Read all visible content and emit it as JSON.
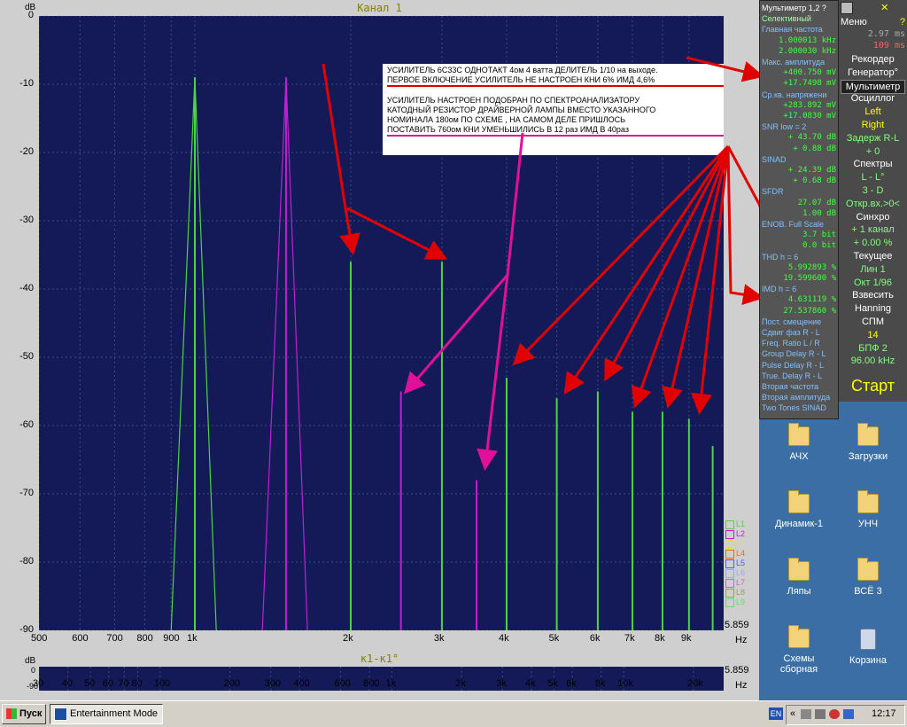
{
  "window": {
    "channel_title": "Канал 1",
    "sub_title": "к1-к1°",
    "db_unit": "dB",
    "hz_unit": "Hz",
    "corner_value": "5.859",
    "sub_corner_value": "5.859",
    "sub_y0": "0",
    "sub_y1": "-90"
  },
  "chart_data": {
    "type": "bar",
    "title": "Канал 1",
    "ylabel": "dB",
    "xlabel": "Hz",
    "xscale": "log",
    "xlim": [
      500,
      10500
    ],
    "ylim": [
      -90,
      0
    ],
    "yticks": [
      "0",
      "-10",
      "-20",
      "-30",
      "-40",
      "-50",
      "-60",
      "-70",
      "-80",
      "-90"
    ],
    "xticks": [
      "500",
      "600",
      "700",
      "800",
      "900",
      "1k",
      "2k",
      "3k",
      "4k",
      "5k",
      "6k",
      "7k",
      "8k",
      "9k"
    ],
    "grid": true,
    "series": [
      {
        "name": "L1",
        "color": "#4ad640",
        "x": [
          1000,
          2000,
          3000,
          4000,
          5000,
          6000,
          7000,
          8000,
          9000,
          10000
        ],
        "values": [
          -9,
          -36,
          -36,
          -53,
          -56,
          -55,
          -58,
          -58,
          -59,
          -63
        ]
      },
      {
        "name": "L2",
        "color": "#c020d0",
        "x": [
          1500,
          2500,
          3500
        ],
        "values": [
          -9,
          -55,
          -68
        ]
      }
    ],
    "legend": [
      "L1",
      "L2",
      "L3",
      "L4",
      "L5",
      "L6",
      "L7",
      "L8",
      "L9"
    ],
    "legend_colors": [
      "#4ad640",
      "#c020d0",
      "#e0e040",
      "#e07020",
      "#4060ff",
      "#a0a0ff",
      "#d060d0",
      "#a0a050",
      "#60e060"
    ],
    "legend_placement": "bottom-right"
  },
  "sub_chart": {
    "xticks": [
      "30",
      "40",
      "50",
      "60",
      "70",
      "80",
      "100",
      "200",
      "300",
      "400",
      "600",
      "800",
      "1k",
      "2k",
      "3k",
      "4k",
      "5k",
      "6k",
      "8k",
      "10k",
      "20k"
    ],
    "xlim": [
      30,
      27000
    ]
  },
  "annotation": {
    "lines1": [
      "УСИЛИТЕЛЬ 6С33С ОДНОТАКТ 4ом  4 ватта ДЕЛИТЕЛЬ 1/10  на выходе.",
      "ПЕРВОЕ ВКЛЮЧЕНИЕ УСИЛИТЕЛЬ НЕ НАСТРОЕН КНИ 6%  ИМД 4,6%"
    ],
    "lines2": [
      "УСИЛИТЕЛЬ  НАСТРОЕН ПОДОБРАН ПО СПЕКТРОАНАЛИЗАТОРУ",
      "КАТОДНЫЙ РЕЗИСТОР ДРАЙВЕРНОЙ ЛАМПЫ  ВМЕСТО УКАЗАННОГО",
      "НОМИНАЛА 180ом  ПО СХЕМЕ , НА САМОМ ДЕЛЕ ПРИШЛОСЬ",
      "ПОСТАВИТЬ 760ом  КНИ УМЕНЬШИЛИСЬ В 12 раз  ИМД В 40раз"
    ]
  },
  "multimeter": [
    {
      "text": "Мультиметр 1,2 ?",
      "color": "#ffffff"
    },
    {
      "text": "Селективный",
      "color": "#a0ffa0"
    },
    {
      "text": "Главная частота",
      "color": "#80c0ff"
    },
    {
      "text": "1.000013 kHz",
      "color": "#40ff40",
      "align": "right"
    },
    {
      "text": "2.000030 kHz",
      "color": "#40ff40",
      "align": "right"
    },
    {
      "text": "Макс. амплитуда",
      "color": "#80c0ff"
    },
    {
      "text": "+400.750 mV",
      "color": "#40ff40",
      "align": "right"
    },
    {
      "text": "+17.7498 mV",
      "color": "#40ff40",
      "align": "right"
    },
    {
      "text": "Ср.кв. напряжени",
      "color": "#80c0ff"
    },
    {
      "text": "+283.892 mV",
      "color": "#40ff40",
      "align": "right"
    },
    {
      "text": "+17.0830 mV",
      "color": "#40ff40",
      "align": "right"
    },
    {
      "text": "SNR      low =   2",
      "color": "#80c0ff"
    },
    {
      "text": "+ 43.70 dB",
      "color": "#40ff40",
      "align": "right"
    },
    {
      "text": "+ 0.88 dB",
      "color": "#40ff40",
      "align": "right"
    },
    {
      "text": "SINAD",
      "color": "#80c0ff"
    },
    {
      "text": "+ 24.39 dB",
      "color": "#40ff40",
      "align": "right"
    },
    {
      "text": "+ 0.68 dB",
      "color": "#40ff40",
      "align": "right"
    },
    {
      "text": "SFDR",
      "color": "#80c0ff"
    },
    {
      "text": "27.07 dB",
      "color": "#40ff40",
      "align": "right"
    },
    {
      "text": "1.00 dB",
      "color": "#40ff40",
      "align": "right"
    },
    {
      "text": "ENOB. Full Scale",
      "color": "#80c0ff"
    },
    {
      "text": "3.7 bit",
      "color": "#40ff40",
      "align": "right"
    },
    {
      "text": "0.0 bit",
      "color": "#40ff40",
      "align": "right"
    },
    {
      "text": "THD         h =   6",
      "color": "#80c0ff"
    },
    {
      "text": "5.992893 %",
      "color": "#40ff40",
      "align": "right"
    },
    {
      "text": "19.599600 %",
      "color": "#40ff40",
      "align": "right"
    },
    {
      "text": "IMD         h =   6",
      "color": "#80c0ff"
    },
    {
      "text": "4.631119 %",
      "color": "#40ff40",
      "align": "right"
    },
    {
      "text": "27.537860 %",
      "color": "#40ff40",
      "align": "right"
    },
    {
      "text": "Пост. смещение",
      "color": "#80c0ff"
    },
    {
      "text": "Сдвиг фаз R - L",
      "color": "#80c0ff"
    },
    {
      "text": "Freq. Ratio  L / R",
      "color": "#80c0ff"
    },
    {
      "text": "Group Delay R - L",
      "color": "#80c0ff"
    },
    {
      "text": "Pulse Delay R - L",
      "color": "#80c0ff"
    },
    {
      "text": "True. Delay R - L",
      "color": "#80c0ff"
    },
    {
      "text": "Вторая частота",
      "color": "#80c0ff"
    },
    {
      "text": "Вторая амплитуда",
      "color": "#80c0ff"
    },
    {
      "text": "Two Tones SINAD",
      "color": "#80c0ff"
    }
  ],
  "menu": {
    "top": [
      "Меню",
      "?",
      "2.97 ms",
      "109 ms"
    ],
    "items": [
      "Рекордер",
      "Генератор°",
      "Мультиметр",
      "Осциллог",
      "Left",
      "Right",
      "Задерж R-L",
      "+ 0",
      "Спектры",
      "L - L°",
      "3 - D",
      "Откр.вх.>0<",
      "Синхро",
      "+ 1 канал",
      "+ 0.00 %",
      "Текущее",
      "Лин       1",
      "Окт  1/96",
      "Взвесить",
      "Hanning",
      "СПМ",
      "14",
      "БПФ  2",
      "96.00 kHz"
    ],
    "start": "Старт"
  },
  "desktop": [
    {
      "label": "АЧХ",
      "type": "folder"
    },
    {
      "label": "Загрузки",
      "type": "folder"
    },
    {
      "label": "Динамик-1",
      "type": "folder"
    },
    {
      "label": "УНЧ",
      "type": "folder"
    },
    {
      "label": "Ляпы",
      "type": "folder"
    },
    {
      "label": "ВСЁ 3",
      "type": "folder"
    },
    {
      "label": "Схемы сборная",
      "type": "folder"
    },
    {
      "label": "Корзина",
      "type": "recycle"
    }
  ],
  "taskbar": {
    "start": "Пуск",
    "task": "Entertainment Mode",
    "lang": "EN",
    "clock": "12:17"
  }
}
